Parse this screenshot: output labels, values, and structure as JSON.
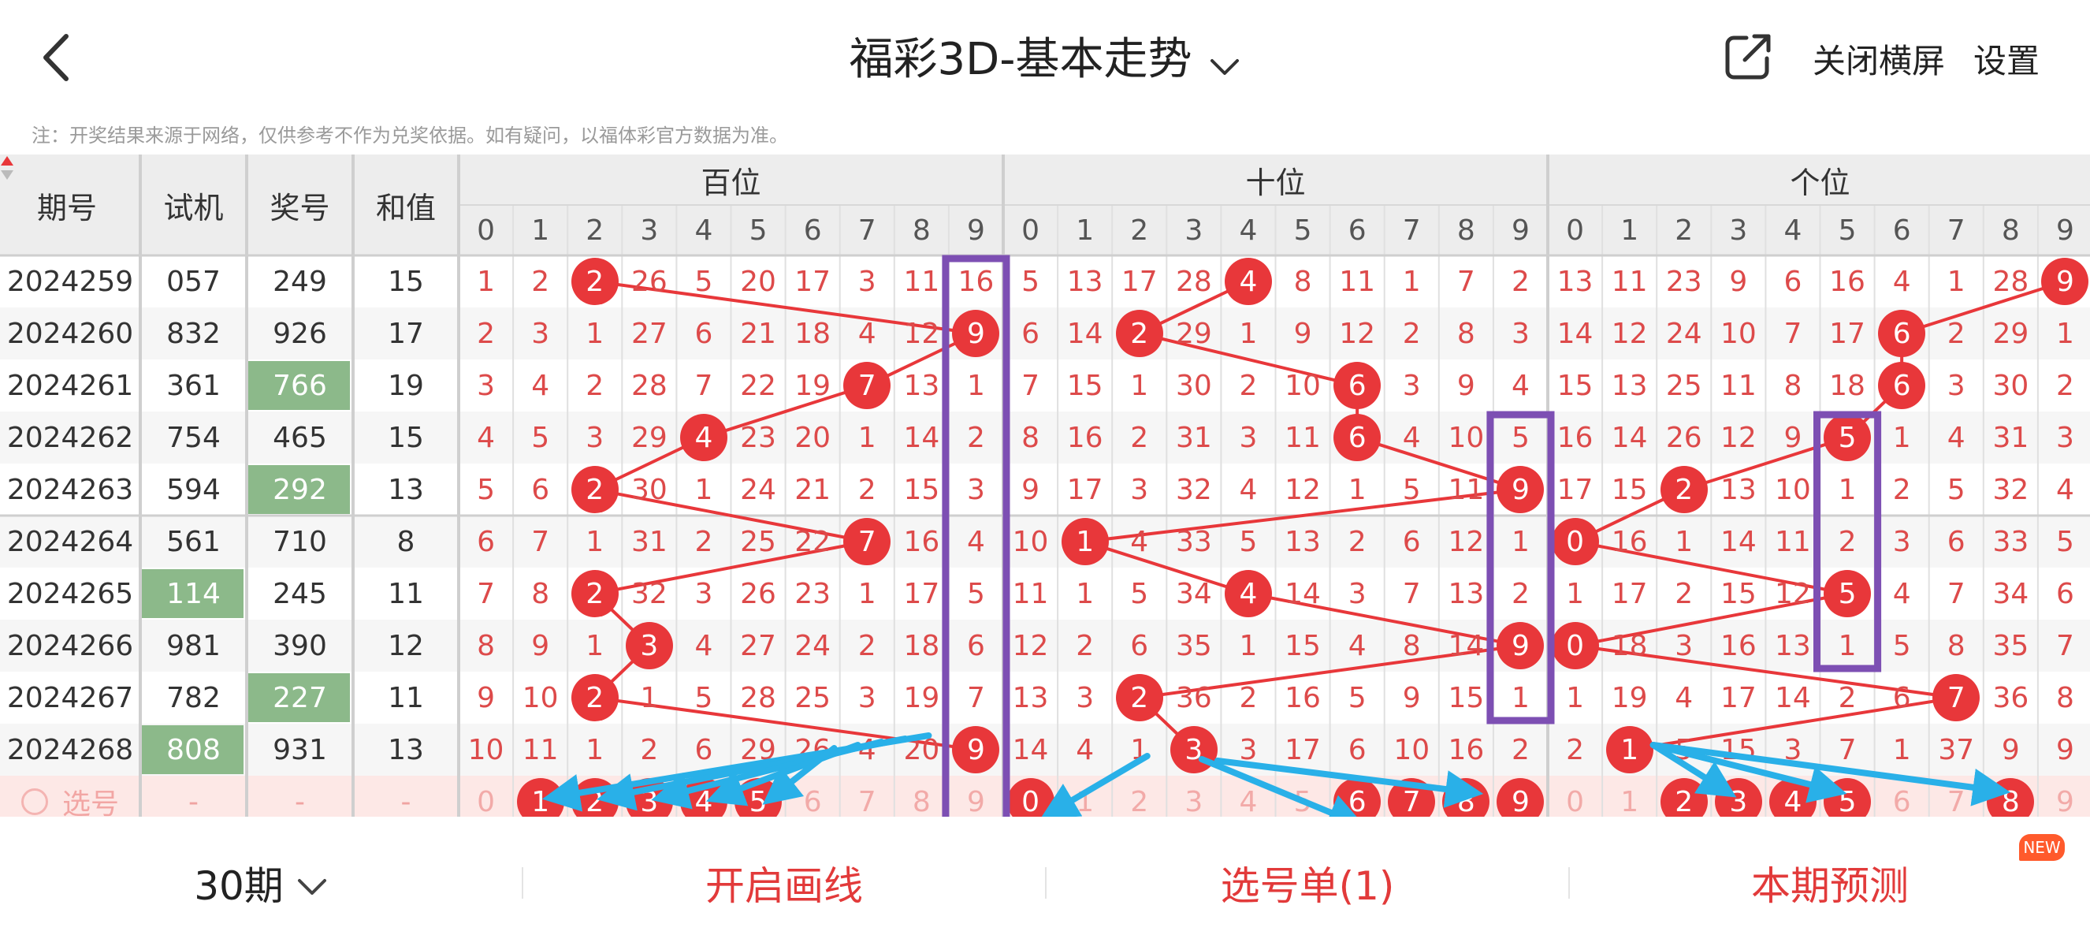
{
  "header": {
    "title": "福彩3D-基本走势",
    "close_landscape": "关闭横屏",
    "settings": "设置"
  },
  "note": "注：开奖结果来源于网络，仅供参考不作为兑奖依据。如有疑问，以福体彩官方数据为准。",
  "table": {
    "columns": {
      "period": "期号",
      "trial": "试机",
      "prize": "奖号",
      "sum": "和值",
      "hundreds": "百位",
      "tens": "十位",
      "units": "个位"
    },
    "digits": [
      "0",
      "1",
      "2",
      "3",
      "4",
      "5",
      "6",
      "7",
      "8",
      "9"
    ],
    "rows": [
      {
        "period": "2024259",
        "trial": "057",
        "prize": "249",
        "sum": "15",
        "h": [
          "1",
          "2",
          "2",
          "26",
          "5",
          "20",
          "17",
          "3",
          "11",
          "16"
        ],
        "t": [
          "5",
          "13",
          "17",
          "28",
          "4",
          "8",
          "11",
          "1",
          "7",
          "2"
        ],
        "u": [
          "13",
          "11",
          "23",
          "9",
          "6",
          "16",
          "4",
          "1",
          "28",
          "9"
        ],
        "hit": [
          2,
          4,
          9
        ],
        "trialHi": false,
        "prizeHi": false
      },
      {
        "period": "2024260",
        "trial": "832",
        "prize": "926",
        "sum": "17",
        "h": [
          "2",
          "3",
          "1",
          "27",
          "6",
          "21",
          "18",
          "4",
          "12",
          "9"
        ],
        "t": [
          "6",
          "14",
          "2",
          "29",
          "1",
          "9",
          "12",
          "2",
          "8",
          "3"
        ],
        "u": [
          "14",
          "12",
          "24",
          "10",
          "7",
          "17",
          "6",
          "2",
          "29",
          "1"
        ],
        "hit": [
          9,
          2,
          6
        ],
        "trialHi": false,
        "prizeHi": false
      },
      {
        "period": "2024261",
        "trial": "361",
        "prize": "766",
        "sum": "19",
        "h": [
          "3",
          "4",
          "2",
          "28",
          "7",
          "22",
          "19",
          "7",
          "13",
          "1"
        ],
        "t": [
          "7",
          "15",
          "1",
          "30",
          "2",
          "10",
          "6",
          "3",
          "9",
          "4"
        ],
        "u": [
          "15",
          "13",
          "25",
          "11",
          "8",
          "18",
          "6",
          "3",
          "30",
          "2"
        ],
        "hit": [
          7,
          6,
          6
        ],
        "trialHi": false,
        "prizeHi": true
      },
      {
        "period": "2024262",
        "trial": "754",
        "prize": "465",
        "sum": "15",
        "h": [
          "4",
          "5",
          "3",
          "29",
          "4",
          "23",
          "20",
          "1",
          "14",
          "2"
        ],
        "t": [
          "8",
          "16",
          "2",
          "31",
          "3",
          "11",
          "6",
          "4",
          "10",
          "5"
        ],
        "u": [
          "16",
          "14",
          "26",
          "12",
          "9",
          "5",
          "1",
          "4",
          "31",
          "3"
        ],
        "hit": [
          4,
          6,
          5
        ],
        "trialHi": false,
        "prizeHi": false
      },
      {
        "period": "2024263",
        "trial": "594",
        "prize": "292",
        "sum": "13",
        "h": [
          "5",
          "6",
          "2",
          "30",
          "1",
          "24",
          "21",
          "2",
          "15",
          "3"
        ],
        "t": [
          "9",
          "17",
          "3",
          "32",
          "4",
          "12",
          "1",
          "5",
          "11",
          "9"
        ],
        "u": [
          "17",
          "15",
          "2",
          "13",
          "10",
          "1",
          "2",
          "5",
          "32",
          "4"
        ],
        "hit": [
          2,
          9,
          2
        ],
        "trialHi": false,
        "prizeHi": true
      },
      {
        "period": "2024264",
        "trial": "561",
        "prize": "710",
        "sum": "8",
        "h": [
          "6",
          "7",
          "1",
          "31",
          "2",
          "25",
          "22",
          "7",
          "16",
          "4"
        ],
        "t": [
          "10",
          "1",
          "4",
          "33",
          "5",
          "13",
          "2",
          "6",
          "12",
          "1"
        ],
        "u": [
          "0",
          "16",
          "1",
          "14",
          "11",
          "2",
          "3",
          "6",
          "33",
          "5"
        ],
        "hit": [
          7,
          1,
          0
        ],
        "trialHi": false,
        "prizeHi": false
      },
      {
        "period": "2024265",
        "trial": "114",
        "prize": "245",
        "sum": "11",
        "h": [
          "7",
          "8",
          "2",
          "32",
          "3",
          "26",
          "23",
          "1",
          "17",
          "5"
        ],
        "t": [
          "11",
          "1",
          "5",
          "34",
          "4",
          "14",
          "3",
          "7",
          "13",
          "2"
        ],
        "u": [
          "1",
          "17",
          "2",
          "15",
          "12",
          "5",
          "4",
          "7",
          "34",
          "6"
        ],
        "hit": [
          2,
          4,
          5
        ],
        "trialHi": true,
        "prizeHi": false
      },
      {
        "period": "2024266",
        "trial": "981",
        "prize": "390",
        "sum": "12",
        "h": [
          "8",
          "9",
          "1",
          "3",
          "4",
          "27",
          "24",
          "2",
          "18",
          "6"
        ],
        "t": [
          "12",
          "2",
          "6",
          "35",
          "1",
          "15",
          "4",
          "8",
          "14",
          "9"
        ],
        "u": [
          "0",
          "18",
          "3",
          "16",
          "13",
          "1",
          "5",
          "8",
          "35",
          "7"
        ],
        "hit": [
          3,
          9,
          0
        ],
        "trialHi": false,
        "prizeHi": false
      },
      {
        "period": "2024267",
        "trial": "782",
        "prize": "227",
        "sum": "11",
        "h": [
          "9",
          "10",
          "2",
          "1",
          "5",
          "28",
          "25",
          "3",
          "19",
          "7"
        ],
        "t": [
          "13",
          "3",
          "2",
          "36",
          "2",
          "16",
          "5",
          "9",
          "15",
          "1"
        ],
        "u": [
          "1",
          "19",
          "4",
          "17",
          "14",
          "2",
          "6",
          "7",
          "36",
          "8"
        ],
        "hit": [
          2,
          2,
          7
        ],
        "trialHi": false,
        "prizeHi": true
      },
      {
        "period": "2024268",
        "trial": "808",
        "prize": "931",
        "sum": "13",
        "h": [
          "10",
          "11",
          "1",
          "2",
          "6",
          "29",
          "26",
          "4",
          "20",
          "9"
        ],
        "t": [
          "14",
          "4",
          "1",
          "3",
          "3",
          "17",
          "6",
          "10",
          "16",
          "2"
        ],
        "u": [
          "2",
          "1",
          "5",
          "15",
          "3",
          "7",
          "1",
          "37",
          "9",
          "9"
        ],
        "hit": [
          9,
          3,
          1
        ],
        "trialHi": true,
        "prizeHi": false
      }
    ],
    "select_row": {
      "label": "选号",
      "dash": "-",
      "h_selected": [
        1,
        2,
        3,
        4,
        5
      ],
      "t_selected": [
        0,
        6,
        7,
        8,
        9
      ],
      "u_selected": [
        2,
        3,
        4,
        5,
        8
      ]
    }
  },
  "bottom": {
    "periods": "30期",
    "draw_line": "开启画线",
    "selection_list": "选号单(1)",
    "prediction": "本期预测",
    "new_badge": "NEW"
  },
  "colors": {
    "accent_red": "#e8373a",
    "highlight_green": "#8cb98a",
    "annotation_purple": "#7d4fb3",
    "annotation_blue": "#29b0e8",
    "digit_red": "#dd4a4a"
  }
}
